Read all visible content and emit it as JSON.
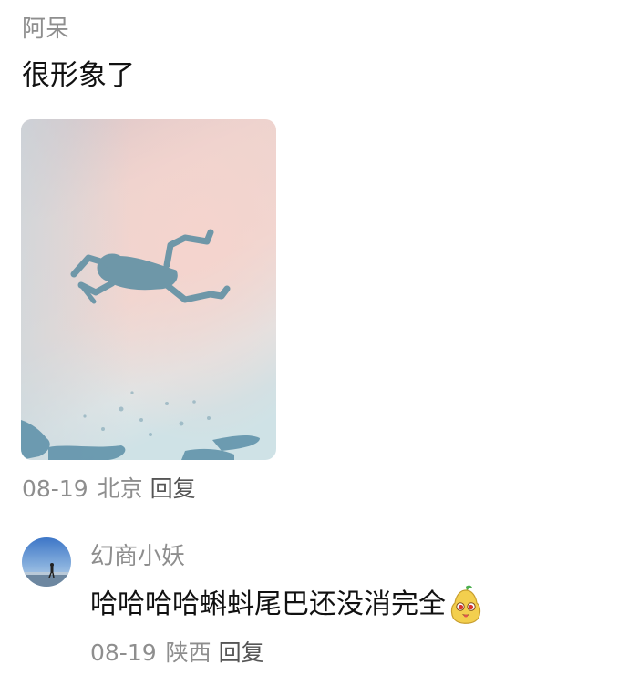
{
  "comment": {
    "username": "阿呆",
    "text": "很形象了",
    "image_description_icon": "photo-tadpole-shadow",
    "date": "08-19",
    "location": "北京",
    "reply_label": "回复"
  },
  "reply": {
    "username": "幻商小妖",
    "text": "哈哈哈哈蝌蚪尾巴还没消完全",
    "emoji_icon": "pear-face-emoji",
    "date": "08-19",
    "location": "陕西",
    "reply_label": "回复"
  },
  "colors": {
    "meta_gray": "#8e8e8e",
    "text": "#111111",
    "reply_action": "#555555"
  }
}
